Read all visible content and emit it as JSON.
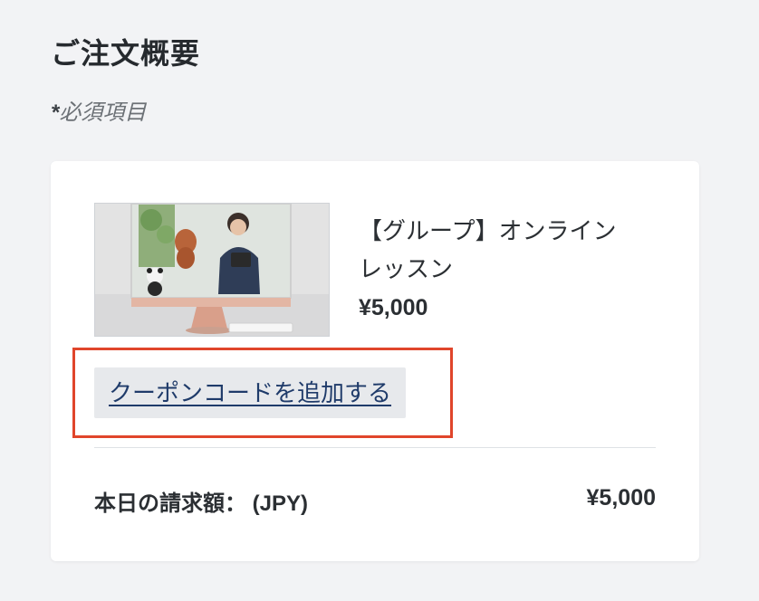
{
  "page": {
    "title": "ご注文概要",
    "required_asterisk": "*",
    "required_text": "必須項目"
  },
  "order_item": {
    "image_alt": "online-lesson-thumbnail",
    "name_line1": "【グループ】オンライン",
    "name_line2": "レッスン",
    "price": "¥5,000"
  },
  "coupon": {
    "button_label": "クーポンコードを追加する"
  },
  "summary": {
    "total_label": "本日の請求額： (JPY)",
    "total_value": "¥5,000"
  },
  "colors": {
    "background": "#f2f3f5",
    "card": "#ffffff",
    "highlight_border": "#e0452b",
    "coupon_button_bg": "#e7e9ec",
    "link_text": "#1f3b6a"
  }
}
